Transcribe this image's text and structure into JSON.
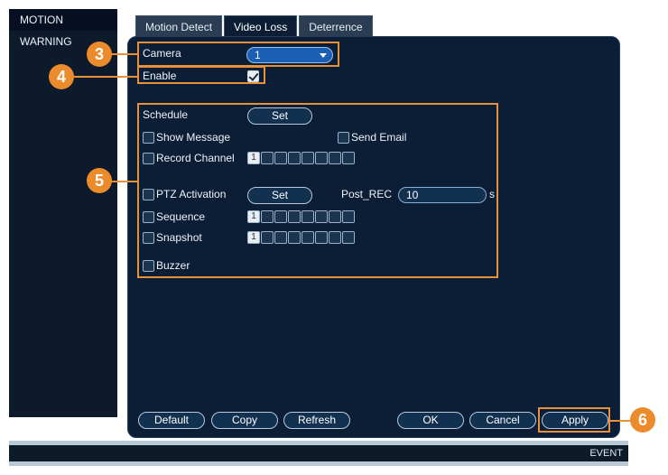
{
  "sidebar": {
    "items": [
      {
        "label": "MOTION"
      },
      {
        "label": "WARNING"
      }
    ]
  },
  "tabs": [
    {
      "label": "Motion Detect"
    },
    {
      "label": "Video Loss"
    },
    {
      "label": "Deterrence"
    }
  ],
  "form": {
    "camera_label": "Camera",
    "camera_value": "1",
    "enable_label": "Enable",
    "enable_checked": true,
    "schedule_label": "Schedule",
    "set_label": "Set",
    "show_message_label": "Show Message",
    "send_email_label": "Send Email",
    "record_channel_label": "Record Channel",
    "ptz_activation_label": "PTZ Activation",
    "post_rec_label": "Post_REC",
    "post_rec_value": "10",
    "post_rec_unit": "s",
    "sequence_label": "Sequence",
    "snapshot_label": "Snapshot",
    "buzzer_label": "Buzzer",
    "channel_first": "1"
  },
  "buttons": {
    "default": "Default",
    "copy": "Copy",
    "refresh": "Refresh",
    "ok": "OK",
    "cancel": "Cancel",
    "apply": "Apply"
  },
  "callouts": {
    "c3": "3",
    "c4": "4",
    "c5": "5",
    "c6": "6"
  },
  "footer": {
    "label": "EVENT"
  },
  "colors": {
    "accent_orange": "#ec8b2b",
    "panel_bg": "#0b1e35",
    "select_blue": "#1a5fb4"
  }
}
